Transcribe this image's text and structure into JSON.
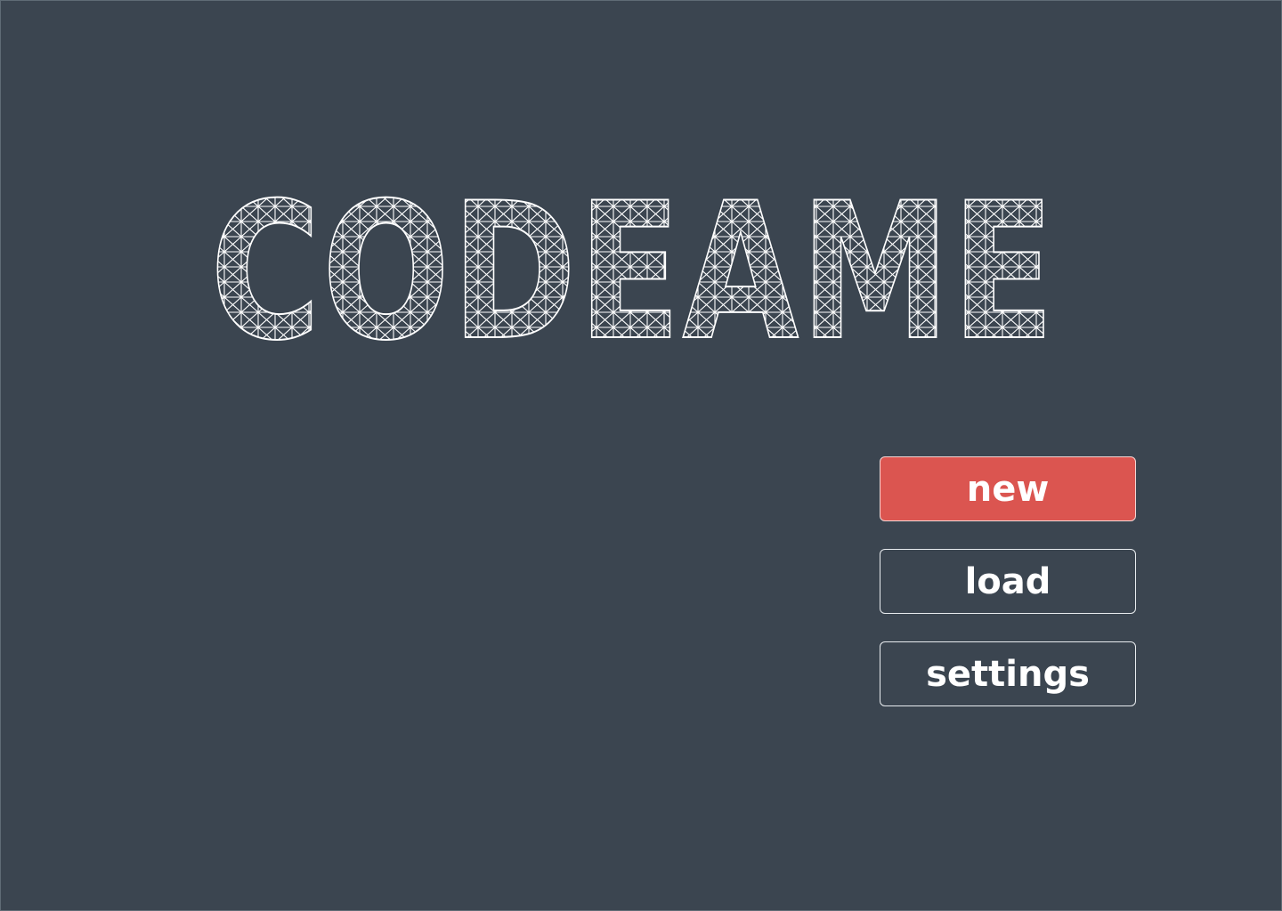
{
  "app": {
    "title": "CODEAME"
  },
  "menu": {
    "new_label": "new",
    "load_label": "load",
    "settings_label": "settings"
  },
  "colors": {
    "background": "#3b4550",
    "accent": "#db5550",
    "outline": "#ffffff"
  }
}
